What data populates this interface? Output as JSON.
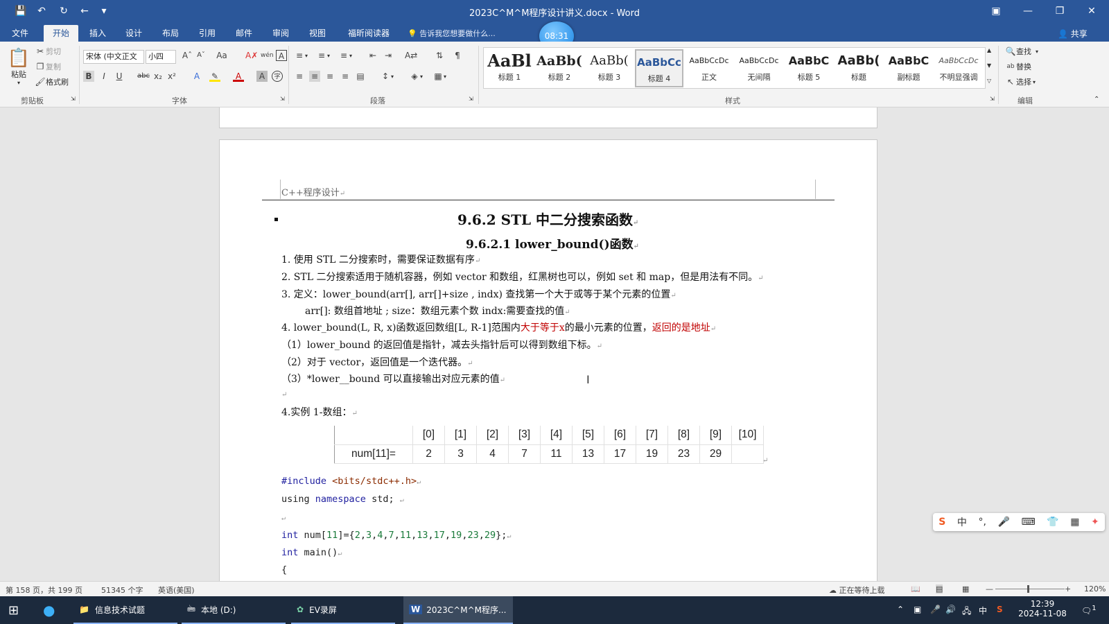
{
  "window": {
    "title": "2023C^M^M程序设计讲义.docx - Word",
    "clock": "08:31"
  },
  "quick_access": {
    "save_icon": "save-icon",
    "undo_icon": "undo-icon",
    "redo_icon": "redo-icon",
    "back_icon": "back-icon",
    "customize_icon": "customize-icon"
  },
  "tabs": [
    "文件",
    "开始",
    "插入",
    "设计",
    "布局",
    "引用",
    "邮件",
    "审阅",
    "视图",
    "福昕阅读器"
  ],
  "active_tab": "开始",
  "tell_me": "告诉我您想要做什么...",
  "share": "共享",
  "ribbon": {
    "clipboard": {
      "paste": "粘贴",
      "cut": "剪切",
      "copy": "复制",
      "format_painter": "格式刷",
      "label": "剪贴板"
    },
    "font": {
      "name": "宋体 (中文正文",
      "size": "小四",
      "label": "字体"
    },
    "paragraph": {
      "label": "段落"
    },
    "styles": {
      "label": "样式",
      "items": [
        {
          "sample": "AaBl",
          "name": "标题 1"
        },
        {
          "sample": "AaBb(",
          "name": "标题 2"
        },
        {
          "sample": "AaBb(",
          "name": "标题 3"
        },
        {
          "sample": "AaBbCc",
          "name": "标题 4"
        },
        {
          "sample": "AaBbCcDc",
          "name": "正文"
        },
        {
          "sample": "AaBbCcDc",
          "name": "无间隔"
        },
        {
          "sample": "AaBbC",
          "name": "标题 5"
        },
        {
          "sample": "AaBb(",
          "name": "标题"
        },
        {
          "sample": "AaBbC",
          "name": "副标题"
        },
        {
          "sample": "AaBbCcDc",
          "name": "不明显强调"
        }
      ],
      "selected": "标题 4"
    },
    "editing": {
      "find": "查找",
      "replace": "替换",
      "select": "选择",
      "label": "编辑"
    }
  },
  "document": {
    "header": "C++程序设计",
    "h1": "9.6.2 STL 中二分搜索函数",
    "h2": "9.6.2.1 lower_bound()函数",
    "lines": {
      "l1": "1. 使用 STL 二分搜索时，需要保证数据有序",
      "l2": "2. STL 二分搜索适用于随机容器，例如 vector 和数组，红黑树也可以，例如 set 和 map，但是用法有不同。",
      "l3": "3. 定义：lower_bound(arr[], arr[]+size , indx) 查找第一个大于或等于某个元素的位置",
      "l3b": "arr[]: 数组首地址 ;   size：数组元素个数    indx:需要查找的值",
      "l4a": "4. lower_bound(L, R, x)函数返回数组[L, R-1]范围内",
      "l4red1": "大于等于x",
      "l4b": "的最小元素的位置，",
      "l4red2": "返回的是地址",
      "p1": "（1）lower_bound 的返回值是指针，减去头指针后可以得到数组下标。",
      "p2": "（2）对于 vector，返回值是一个迭代器。",
      "p3": "（3）*lower__bound 可以直接输出对应元素的值",
      "ex": "4.实例 1-数组："
    },
    "table": {
      "headers": [
        "",
        "[0]",
        "[1]",
        "[2]",
        "[3]",
        "[4]",
        "[5]",
        "[6]",
        "[7]",
        "[8]",
        "[9]",
        "[10]"
      ],
      "row_label": "num[11]=",
      "values": [
        "2",
        "3",
        "4",
        "7",
        "11",
        "13",
        "17",
        "19",
        "23",
        "29",
        ""
      ]
    },
    "code": {
      "include_kw": "#include",
      "include_file": "<bits/stdc++.h>",
      "using": "using",
      "namespace": "namespace",
      "std": "std;",
      "int": "int",
      "array_decl": "num[",
      "array_size": "11",
      "array_rest": "]={",
      "values": [
        "2",
        "3",
        "4",
        "7",
        "11",
        "13",
        "17",
        "19",
        "23",
        "29"
      ],
      "array_end": "};",
      "main": "main()",
      "brace": "{"
    }
  },
  "status": {
    "page": "第 158 页，共 199 页",
    "words": "51345 个字",
    "language": "英语(美国)",
    "upload": "正在等待上载",
    "zoom": "120%"
  },
  "taskbar": {
    "items": [
      "信息技术试题",
      "本地 (D:)",
      "EV录屏",
      "2023C^M^M程序..."
    ],
    "time": "12:39",
    "date": "2024-11-08",
    "ime": "中",
    "notifications": "1"
  },
  "ime_bar": {
    "mode": "中"
  }
}
